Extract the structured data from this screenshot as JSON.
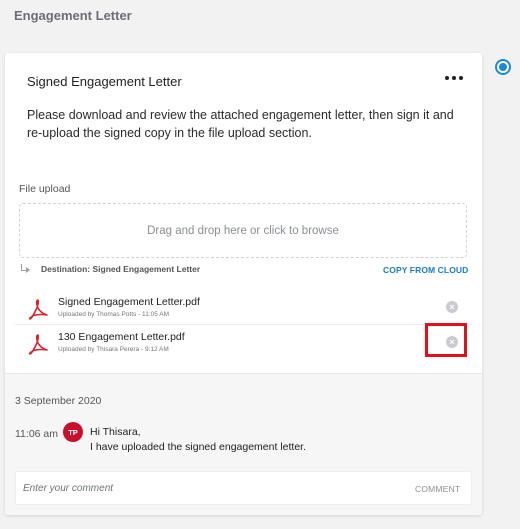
{
  "section": {
    "title": "Engagement Letter"
  },
  "card": {
    "title": "Signed Engagement Letter",
    "more_icon": "more-horizontal-icon",
    "instructions": "Please download and review the attached engagement letter, then sign it and re-upload the signed copy in the file upload section."
  },
  "upload": {
    "label": "File upload",
    "dropzone_text": "Drag and drop here or click to browse",
    "destination": "Destination: Signed Engagement Letter",
    "copy_from_cloud": "COPY FROM CLOUD",
    "files": [
      {
        "name": "Signed Engagement Letter.pdf",
        "meta": "Uploaded by Thomas Potts - 11:05 AM"
      },
      {
        "name": "130 Engagement Letter.pdf",
        "meta": "Uploaded by Thisara Perera - 9:12 AM"
      }
    ]
  },
  "activity": {
    "date": "3 September 2020",
    "time": "11:06 am",
    "avatar_initials": "TP",
    "message_line1": "Hi Thisara,",
    "message_line2": "I have uploaded the signed engagement letter."
  },
  "comment": {
    "placeholder": "Enter your comment",
    "button": "COMMENT"
  },
  "colors": {
    "accent": "#1a8ad4",
    "link": "#1a7fc4",
    "pdf_red": "#d9232e",
    "avatar": "#c8102e",
    "highlight": "#e3101b"
  }
}
